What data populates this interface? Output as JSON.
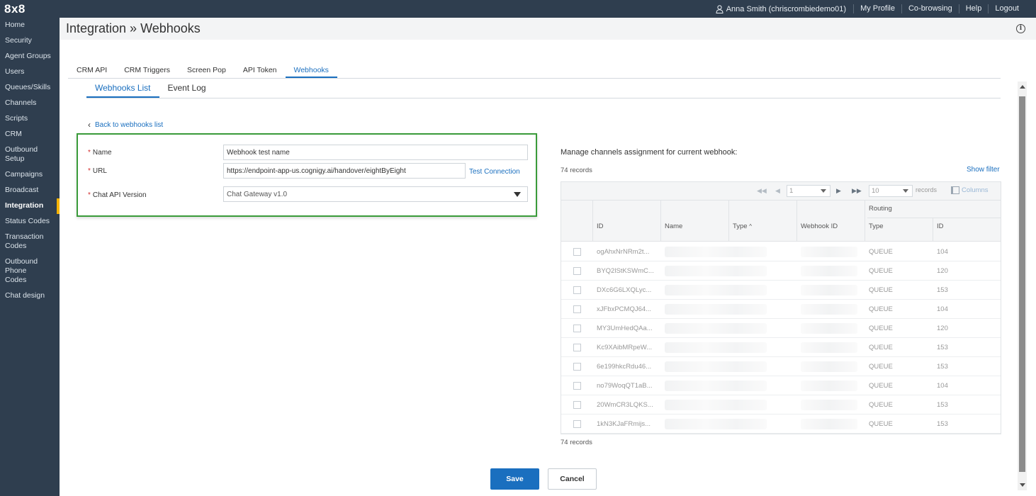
{
  "brand": "8x8",
  "topnav": {
    "user": "Anna Smith (chriscrombiedemo01)",
    "links": [
      "My Profile",
      "Co-browsing",
      "Help",
      "Logout"
    ]
  },
  "sidebar": {
    "items": [
      {
        "label": "Home"
      },
      {
        "label": "Security"
      },
      {
        "label": "Agent Groups"
      },
      {
        "label": "Users"
      },
      {
        "label": "Queues/Skills"
      },
      {
        "label": "Channels"
      },
      {
        "label": "Scripts"
      },
      {
        "label": "CRM"
      },
      {
        "label": "Outbound Setup"
      },
      {
        "label": "Campaigns"
      },
      {
        "label": "Broadcast"
      },
      {
        "label": "Integration",
        "active": true
      },
      {
        "label": "Status Codes"
      },
      {
        "label": "Transaction Codes"
      },
      {
        "label": "Outbound Phone Codes"
      },
      {
        "label": "Chat design"
      }
    ],
    "accent": "#f5b300"
  },
  "page": {
    "title": "Integration » Webhooks"
  },
  "tabs": [
    "CRM API",
    "CRM Triggers",
    "Screen Pop",
    "API Token",
    "Webhooks"
  ],
  "subtabs": [
    "Webhooks List",
    "Event Log"
  ],
  "back_link": "Back to webhooks list",
  "form": {
    "name_label": "Name",
    "name_value": "Webhook test name",
    "url_label": "URL",
    "url_value": "https://endpoint-app-us.cognigy.ai/handover/eightByEight",
    "test_connection": "Test Connection",
    "version_label": "Chat API Version",
    "version_value": "Chat Gateway v1.0",
    "required_mark": "*"
  },
  "channels": {
    "title": "Manage channels assignment for current webhook:",
    "records": "74 records",
    "show_filter": "Show filter",
    "pager": {
      "page": "1",
      "page_size": "10",
      "records_label": "records",
      "columns_label": "Columns"
    },
    "headers": {
      "id": "ID",
      "name": "Name",
      "type": "Type",
      "webhook_id": "Webhook ID",
      "routing": "Routing",
      "routing_type": "Type",
      "routing_id": "ID"
    },
    "rows": [
      {
        "id": "ogAhxNrNRm2t...",
        "rtype": "QUEUE",
        "rid": "104"
      },
      {
        "id": "BYQ2lStKSWmC...",
        "rtype": "QUEUE",
        "rid": "120"
      },
      {
        "id": "DXc6G6LXQLyc...",
        "rtype": "QUEUE",
        "rid": "153"
      },
      {
        "id": "xJFbxPCMQJ64...",
        "rtype": "QUEUE",
        "rid": "104"
      },
      {
        "id": "MY3UmHedQAa...",
        "rtype": "QUEUE",
        "rid": "120"
      },
      {
        "id": "Kc9XAibMRpeW...",
        "rtype": "QUEUE",
        "rid": "153"
      },
      {
        "id": "6e199hkcRdu46...",
        "rtype": "QUEUE",
        "rid": "153"
      },
      {
        "id": "no79WoqQT1aB...",
        "rtype": "QUEUE",
        "rid": "104"
      },
      {
        "id": "20WmCR3LQKS...",
        "rtype": "QUEUE",
        "rid": "153"
      },
      {
        "id": "1kN3KJaFRmijs...",
        "rtype": "QUEUE",
        "rid": "153"
      }
    ]
  },
  "buttons": {
    "save": "Save",
    "cancel": "Cancel"
  },
  "colors": {
    "accent": "#1a6fbf",
    "highlight_border": "#3a9b3a",
    "nav_bg": "#2f3e4f"
  }
}
